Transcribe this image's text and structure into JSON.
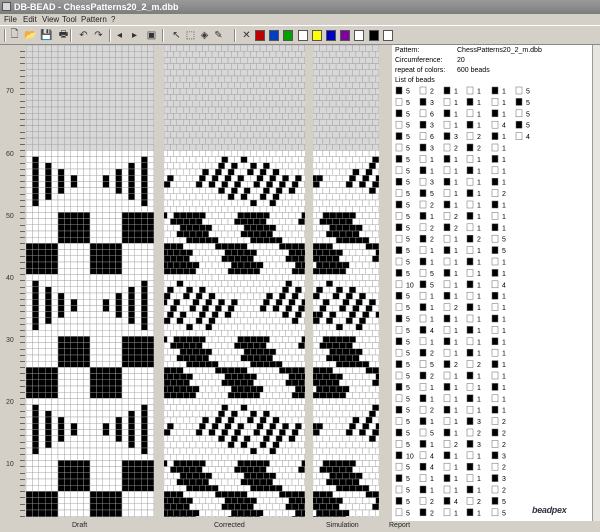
{
  "window": {
    "title": "DB-BEAD - ChessPatterns20_2_m.dbb"
  },
  "menu": [
    "File",
    "Edit",
    "View",
    "Tool",
    "Pattern",
    "?"
  ],
  "toolbar": {
    "buttons": [
      {
        "name": "new-file-icon",
        "glyph": "🗋"
      },
      {
        "name": "open-folder-icon",
        "glyph": "📂"
      },
      {
        "name": "save-icon",
        "glyph": "💾"
      },
      {
        "name": "print-icon",
        "glyph": "🖶"
      },
      {
        "name": "undo-icon",
        "glyph": "↶"
      },
      {
        "name": "redo-icon",
        "glyph": "↷"
      },
      {
        "name": "arrow-left-icon",
        "glyph": "◂"
      },
      {
        "name": "arrow-right-icon",
        "glyph": "▸"
      },
      {
        "name": "preview-icon",
        "glyph": "▣"
      },
      {
        "name": "pointer-icon",
        "glyph": "↖"
      },
      {
        "name": "select-rect-icon",
        "glyph": "⬚"
      },
      {
        "name": "fill-bucket-icon",
        "glyph": "◈"
      },
      {
        "name": "color-picker-icon",
        "glyph": "✎"
      },
      {
        "name": "delete-icon",
        "glyph": "✕"
      }
    ],
    "colors": [
      "#c00000",
      "#0040c0",
      "#00a000",
      "#ffffff",
      "#ffff00",
      "#0000c0",
      "#8000a0",
      "#ffffff",
      "#000000",
      "#ffffff"
    ]
  },
  "ruler": {
    "labels": [
      "70",
      "60",
      "50",
      "40",
      "30",
      "20",
      "10"
    ]
  },
  "report": {
    "pattern_label": "Pattern:",
    "pattern_value": "ChessPatterns20_2_m.dbb",
    "circ_label": "Circumference:",
    "circ_value": "20",
    "repeat_label": "repeat of colors:",
    "repeat_value": "600 beads",
    "list_label": "List of beads",
    "bead_rows": [
      [
        "5",
        "2",
        "1",
        "1",
        "1",
        "5"
      ],
      [
        "5",
        "3",
        "1",
        "1",
        "1",
        "5"
      ],
      [
        "5",
        "6",
        "1",
        "1",
        "1",
        "5"
      ],
      [
        "5",
        "3",
        "1",
        "1",
        "4",
        "5"
      ],
      [
        "5",
        "6",
        "3",
        "2",
        "1",
        "4"
      ],
      [
        "5",
        "3",
        "2",
        "2",
        "1",
        ""
      ],
      [
        "5",
        "1",
        "1",
        "1",
        "1",
        ""
      ],
      [
        "5",
        "1",
        "1",
        "1",
        "1",
        ""
      ],
      [
        "5",
        "3",
        "1",
        "1",
        "1",
        ""
      ],
      [
        "5",
        "5",
        "1",
        "1",
        "2",
        ""
      ],
      [
        "5",
        "2",
        "1",
        "1",
        "1",
        ""
      ],
      [
        "5",
        "1",
        "2",
        "1",
        "1",
        ""
      ],
      [
        "5",
        "2",
        "2",
        "1",
        "1",
        ""
      ],
      [
        "5",
        "2",
        "1",
        "2",
        "5",
        ""
      ],
      [
        "5",
        "1",
        "1",
        "1",
        "5",
        ""
      ],
      [
        "5",
        "1",
        "1",
        "1",
        "1",
        ""
      ],
      [
        "5",
        "5",
        "1",
        "1",
        "1",
        ""
      ],
      [
        "10",
        "5",
        "1",
        "1",
        "4",
        ""
      ],
      [
        "5",
        "1",
        "1",
        "1",
        "1",
        ""
      ],
      [
        "5",
        "1",
        "2",
        "1",
        "1",
        ""
      ],
      [
        "5",
        "1",
        "1",
        "1",
        "1",
        ""
      ],
      [
        "5",
        "4",
        "1",
        "1",
        "1",
        ""
      ],
      [
        "5",
        "1",
        "1",
        "1",
        "1",
        ""
      ],
      [
        "5",
        "2",
        "1",
        "1",
        "1",
        ""
      ],
      [
        "5",
        "5",
        "2",
        "2",
        "1",
        ""
      ],
      [
        "5",
        "2",
        "1",
        "1",
        "1",
        ""
      ],
      [
        "5",
        "1",
        "1",
        "1",
        "1",
        ""
      ],
      [
        "5",
        "1",
        "1",
        "1",
        "1",
        ""
      ],
      [
        "5",
        "2",
        "1",
        "1",
        "1",
        ""
      ],
      [
        "5",
        "1",
        "1",
        "3",
        "2",
        ""
      ],
      [
        "5",
        "5",
        "1",
        "2",
        "2",
        ""
      ],
      [
        "5",
        "1",
        "2",
        "3",
        "2",
        ""
      ],
      [
        "10",
        "4",
        "1",
        "1",
        "3",
        ""
      ],
      [
        "5",
        "4",
        "1",
        "1",
        "2",
        ""
      ],
      [
        "5",
        "1",
        "1",
        "1",
        "3",
        ""
      ],
      [
        "5",
        "1",
        "1",
        "1",
        "2",
        ""
      ],
      [
        "5",
        "2",
        "4",
        "2",
        "5",
        ""
      ],
      [
        "5",
        "2",
        "1",
        "1",
        "5",
        ""
      ]
    ]
  },
  "statusbar": {
    "draft": "Draft",
    "corrected": "Corrected",
    "simulation": "Simulation",
    "report": "Report"
  },
  "brand": "beadpex"
}
